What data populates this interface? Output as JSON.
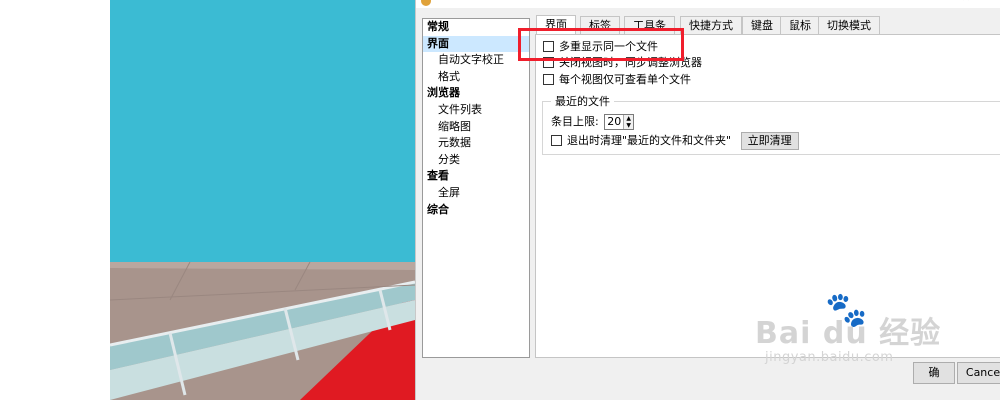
{
  "dialog": {
    "ok_label": "确",
    "cancel_label": "Cance"
  },
  "nav": {
    "items": [
      {
        "label": "常规"
      },
      {
        "label": "界面"
      },
      {
        "label": "自动文字校正"
      },
      {
        "label": "格式"
      },
      {
        "label": "浏览器"
      },
      {
        "label": "文件列表"
      },
      {
        "label": "缩略图"
      },
      {
        "label": "元数据"
      },
      {
        "label": "分类"
      },
      {
        "label": "查看"
      },
      {
        "label": "全屏"
      },
      {
        "label": "综合"
      }
    ],
    "selected": "界面"
  },
  "tabs": [
    "界面",
    "标签",
    "工具条",
    "快捷方式",
    "键盘",
    "鼠标",
    "切换模式"
  ],
  "options": {
    "multi_display": "多重显示同一个文件",
    "sync_view": "关闭视图时，同步调整浏览器",
    "single_file_per_view": "每个视图仅可查看单个文件"
  },
  "recent": {
    "title": "最近的文件",
    "limit_label": "条目上限:",
    "limit_value": "20",
    "clear_on_exit": "退出时清理\"最近的文件和文件夹\"",
    "clear_now": "立即清理"
  },
  "watermark": {
    "brand": "Bai du 经验",
    "url": "jingyan.baidu.com"
  },
  "colors": {
    "highlight": "#f01e2c",
    "sky": "#3bbbd3",
    "selection": "#cce8ff"
  }
}
